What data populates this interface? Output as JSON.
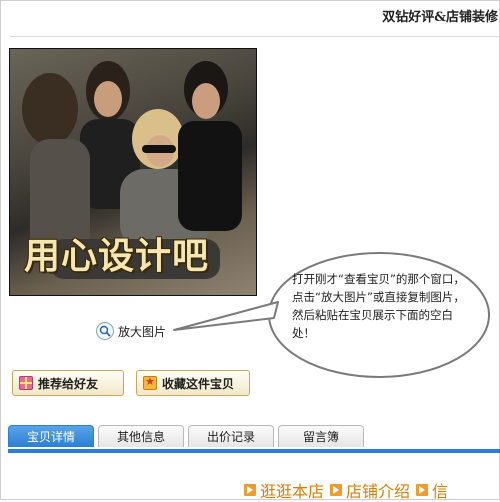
{
  "header": {
    "title": "双钻好评&店铺装修"
  },
  "product": {
    "overlay_text": "用心设计吧"
  },
  "zoom": {
    "label": "放大图片"
  },
  "callout": {
    "text": "打开刚才“查看宝贝”的那个窗口，点击“放大图片”或直接复制图片，然后粘贴在宝贝展示下面的空白处！"
  },
  "actions": {
    "recommend_label": "推荐给好友",
    "favorite_label": "收藏这件宝贝"
  },
  "tabs": [
    {
      "label": "宝贝详情",
      "active": true
    },
    {
      "label": "其他信息",
      "active": false
    },
    {
      "label": "出价记录",
      "active": false
    },
    {
      "label": "留言簿",
      "active": false
    }
  ],
  "footer": {
    "links": [
      "逛逛本店",
      "店铺介绍",
      "信"
    ]
  },
  "colors": {
    "accent": "#2a7fd4",
    "link": "#e27b00",
    "button_border": "#c9a959"
  }
}
